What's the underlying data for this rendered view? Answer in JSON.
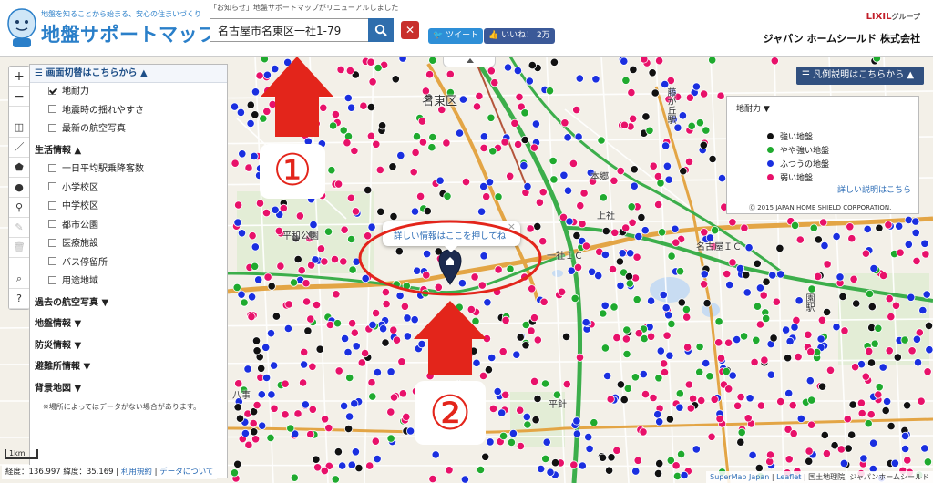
{
  "header": {
    "tagline": "地盤を知ることから始まる、安心の住まいづくり",
    "app_title": "地盤サポートマップ",
    "notice": "「お知らせ」地盤サポートマップがリニューアルしました",
    "search": {
      "value": "名古屋市名東区一社1-79",
      "placeholder": ""
    },
    "tweet_label": "ツイート",
    "like_label": "いいね！ 2万",
    "brand_lixil": "LIXIL",
    "brand_group": "グループ",
    "company_name": "ジャパン ホームシールド 株式会社"
  },
  "layer_panel": {
    "header_label": "画面切替はこちらから",
    "items": [
      {
        "label": "地耐力",
        "checked": true
      },
      {
        "label": "地震時の揺れやすさ",
        "checked": false
      },
      {
        "label": "最新の航空写真",
        "checked": false
      }
    ],
    "life_section": {
      "label": "生活情報",
      "items": [
        {
          "label": "一日平均駅乗降客数"
        },
        {
          "label": "小学校区"
        },
        {
          "label": "中学校区"
        },
        {
          "label": "都市公園"
        },
        {
          "label": "医療施設"
        },
        {
          "label": "バス停留所"
        },
        {
          "label": "用途地域"
        }
      ]
    },
    "sections": [
      {
        "label": "過去の航空写真"
      },
      {
        "label": "地盤情報"
      },
      {
        "label": "防災情報"
      },
      {
        "label": "避難所情報"
      },
      {
        "label": "背景地図"
      }
    ],
    "note": "※場所によってはデータがない場合があります。"
  },
  "legend": {
    "button_label": "凡例説明はこちらから",
    "title": "地耐力",
    "items": [
      {
        "label": "強い地盤",
        "color": "#111111"
      },
      {
        "label": "やや強い地盤",
        "color": "#1faa2e"
      },
      {
        "label": "ふつうの地盤",
        "color": "#1a2fe0"
      },
      {
        "label": "弱い地盤",
        "color": "#e8116a"
      }
    ],
    "more_link": "詳しい説明はこちら",
    "copyright": "Ⓒ 2015 JAPAN HOME SHIELD CORPORATION."
  },
  "popup": {
    "text": "詳しい情報はここを押してね",
    "close": "×"
  },
  "annotations": {
    "marker_1": "①",
    "marker_2": "②",
    "color": "#e3251b"
  },
  "map": {
    "labels": {
      "meito_ku": "名東区",
      "heiwa_koen": "平和公園",
      "fujigaoka": "藤が丘駅",
      "hongo": "本郷",
      "issha_ic": "一社ＩＣ",
      "meito_ic": "名古屋ＩＣ",
      "kami_yashiro": "上社",
      "gokiso": "園駅",
      "hirabari": "平針",
      "yagoto": "八事"
    }
  },
  "footer": {
    "scale": "1km",
    "coords": "経度：136.997 緯度：35.169",
    "terms_link": "利用規約",
    "data_link": "データについて",
    "attr_1": "SuperMap Japan",
    "attr_2": "Leaflet",
    "attr_3": "国土地理院, ジャパンホームシールド"
  },
  "colors": {
    "strong": "#111111",
    "fairly_strong": "#1faa2e",
    "normal": "#1a2fe0",
    "weak": "#e8116a",
    "road_highway": "#3cae4b",
    "road_main": "#e3a545"
  }
}
